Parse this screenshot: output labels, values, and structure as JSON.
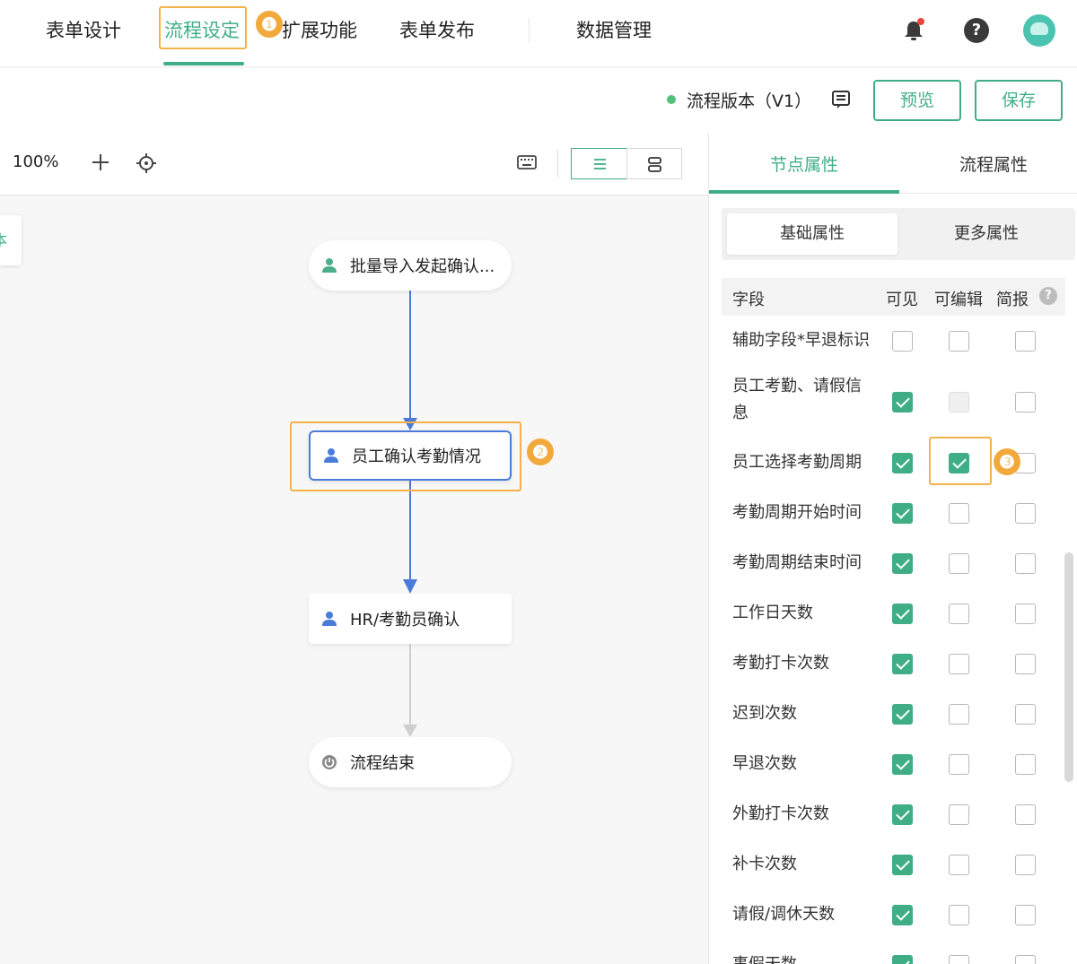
{
  "nav": {
    "items": [
      "表单设计",
      "流程设定",
      "扩展功能",
      "表单发布",
      "数据管理"
    ],
    "active_index": 1
  },
  "annotations": [
    "❶",
    "❷",
    "❸"
  ],
  "toolbar": {
    "status_color": "#54c07c",
    "version_label": "流程版本（V1）",
    "preview_label": "预览",
    "save_label": "保存"
  },
  "canvas": {
    "zoom": "100%",
    "side_tab_label": "本",
    "nodes": [
      {
        "label": "批量导入发起确认...",
        "icon": "user-icon",
        "icon_color": "#4cae8a"
      },
      {
        "label": "员工确认考勤情况",
        "icon": "user-icon",
        "icon_color": "#4a7bd8"
      },
      {
        "label": "HR/考勤员确认",
        "icon": "user-icon",
        "icon_color": "#4a7bd8"
      },
      {
        "label": "流程结束",
        "icon": "power-icon",
        "icon_color": "#888888"
      }
    ]
  },
  "panel": {
    "tabs": [
      "节点属性",
      "流程属性"
    ],
    "subtabs": [
      "基础属性",
      "更多属性"
    ],
    "columns": [
      "字段",
      "可见",
      "可编辑",
      "简报"
    ],
    "rows": [
      {
        "field": "辅助字段*早退标识",
        "visible": false,
        "editable": false,
        "brief": false
      },
      {
        "field": "员工考勤、请假信息",
        "visible": true,
        "editable": "disabled",
        "brief": false
      },
      {
        "field": "员工选择考勤周期",
        "visible": true,
        "editable": true,
        "brief": false
      },
      {
        "field": "考勤周期开始时间",
        "visible": true,
        "editable": false,
        "brief": false
      },
      {
        "field": "考勤周期结束时间",
        "visible": true,
        "editable": false,
        "brief": false
      },
      {
        "field": "工作日天数",
        "visible": true,
        "editable": false,
        "brief": false
      },
      {
        "field": "考勤打卡次数",
        "visible": true,
        "editable": false,
        "brief": false
      },
      {
        "field": "迟到次数",
        "visible": true,
        "editable": false,
        "brief": false
      },
      {
        "field": "早退次数",
        "visible": true,
        "editable": false,
        "brief": false
      },
      {
        "field": "外勤打卡次数",
        "visible": true,
        "editable": false,
        "brief": false
      },
      {
        "field": "补卡次数",
        "visible": true,
        "editable": false,
        "brief": false
      },
      {
        "field": "请假/调休天数",
        "visible": true,
        "editable": false,
        "brief": false
      },
      {
        "field": "事假天数",
        "visible": true,
        "editable": false,
        "brief": false
      }
    ]
  },
  "colors": {
    "accent": "#3fae86",
    "highlight": "#f4b24a",
    "selected_node": "#4a7bd8"
  }
}
